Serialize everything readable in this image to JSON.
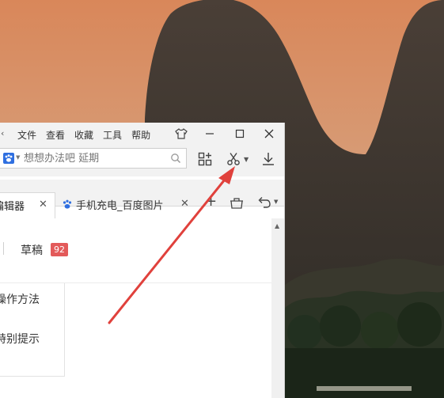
{
  "menu": {
    "chevron_glyph": "‹",
    "items": [
      "文件",
      "查看",
      "收藏",
      "工具",
      "帮助"
    ]
  },
  "search": {
    "engine_icon": "baidu-paw-icon",
    "placeholder": "想想办法吧 延期"
  },
  "toolbar": {
    "icons": [
      "apps-grid-icon",
      "scissors-icon",
      "chevron-down-icon",
      "download-icon"
    ]
  },
  "tabs": {
    "active_title": "编辑器",
    "second_title": "手机充电_百度图片",
    "close_glyph": "✕",
    "new_tab_glyph": "+"
  },
  "content": {
    "drafts_label": "草稿",
    "drafts_count": "92",
    "list_items": [
      "操作方法",
      "特别提示"
    ]
  },
  "colors": {
    "badge": "#e35a5a",
    "annotation_arrow": "#e0413c",
    "chrome": "#f2f2f2",
    "baidu_blue": "#2f6fe0"
  }
}
